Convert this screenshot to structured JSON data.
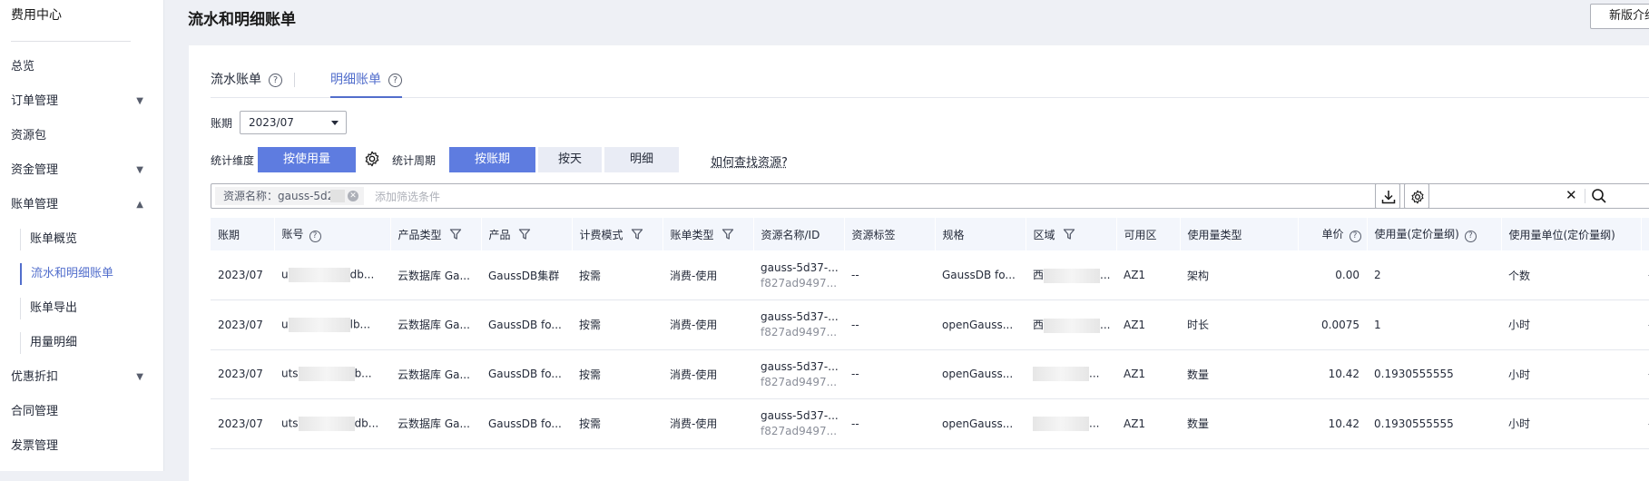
{
  "sidebar": {
    "title": "费用中心",
    "items": [
      {
        "label": "总览",
        "chevron": ""
      },
      {
        "label": "订单管理",
        "chevron": "▼"
      },
      {
        "label": "资源包",
        "chevron": ""
      },
      {
        "label": "资金管理",
        "chevron": "▼"
      },
      {
        "label": "账单管理",
        "chevron": "▲"
      }
    ],
    "subitems": [
      {
        "label": "账单概览"
      },
      {
        "label": "流水和明细账单"
      },
      {
        "label": "账单导出"
      },
      {
        "label": "用量明细"
      }
    ],
    "items_after": [
      {
        "label": "优惠折扣",
        "chevron": "▼"
      },
      {
        "label": "合同管理",
        "chevron": ""
      },
      {
        "label": "发票管理",
        "chevron": ""
      }
    ]
  },
  "header": {
    "title": "流水和明细账单",
    "intro_button": "新版介绍"
  },
  "tabs": [
    {
      "label": "流水账单",
      "help": "?"
    },
    {
      "label": "明细账单",
      "help": "?"
    }
  ],
  "period": {
    "label": "账期",
    "value": "2023/07"
  },
  "dimension": {
    "label": "统计维度",
    "value": "按使用量"
  },
  "cycle": {
    "label": "统计周期",
    "options": [
      "按账期",
      "按天",
      "明细"
    ]
  },
  "how_link": "如何查找资源?",
  "filter": {
    "chip": "资源名称：gauss-5d2",
    "placeholder": "添加筛选条件",
    "clear": "✕"
  },
  "table": {
    "columns": [
      "账期",
      "账号",
      "产品类型",
      "产品",
      "计费模式",
      "账单类型",
      "资源名称/ID",
      "资源标签",
      "规格",
      "区域",
      "可用区",
      "使用量类型",
      "单价",
      "使用量(定价量纲)",
      "使用量单位(定价量纲)",
      "套"
    ],
    "rows": [
      {
        "period": "2023/07",
        "acct_pre": "u",
        "acct_suf": "db...",
        "ptype": "云数据库 Ga...",
        "product": "GaussDB集群",
        "mode": "按需",
        "btype": "消费-使用",
        "res1": "gauss-5d37-...",
        "res2": "f827ad9497...",
        "tag": "--",
        "spec": "GaussDB fo...",
        "region_pre": "西",
        "az": "AZ1",
        "utype": "架构",
        "price": "0.00",
        "usage": "2",
        "unit": "个数",
        "last": "-"
      },
      {
        "period": "2023/07",
        "acct_pre": "u",
        "acct_suf": "lb...",
        "ptype": "云数据库 Ga...",
        "product": "GaussDB fo...",
        "mode": "按需",
        "btype": "消费-使用",
        "res1": "gauss-5d37-...",
        "res2": "f827ad9497...",
        "tag": "--",
        "spec": "openGauss...",
        "region_pre": "西",
        "az": "AZ1",
        "utype": "时长",
        "price": "0.0075",
        "usage": "1",
        "unit": "小时",
        "last": "-"
      },
      {
        "period": "2023/07",
        "acct_pre": "uts",
        "acct_suf": "b...",
        "ptype": "云数据库 Ga...",
        "product": "GaussDB fo...",
        "mode": "按需",
        "btype": "消费-使用",
        "res1": "gauss-5d37-...",
        "res2": "f827ad9497...",
        "tag": "--",
        "spec": "openGauss...",
        "region_pre": "",
        "az": "AZ1",
        "utype": "数量",
        "price": "10.42",
        "usage": "0.1930555555",
        "unit": "小时",
        "last": "-"
      },
      {
        "period": "2023/07",
        "acct_pre": "uts",
        "acct_suf": "db...",
        "ptype": "云数据库 Ga...",
        "product": "GaussDB fo...",
        "mode": "按需",
        "btype": "消费-使用",
        "res1": "gauss-5d37-...",
        "res2": "f827ad9497...",
        "tag": "--",
        "spec": "openGauss...",
        "region_pre": "",
        "az": "AZ1",
        "utype": "数量",
        "price": "10.42",
        "usage": "0.1930555555",
        "unit": "小时",
        "last": "-"
      }
    ]
  }
}
